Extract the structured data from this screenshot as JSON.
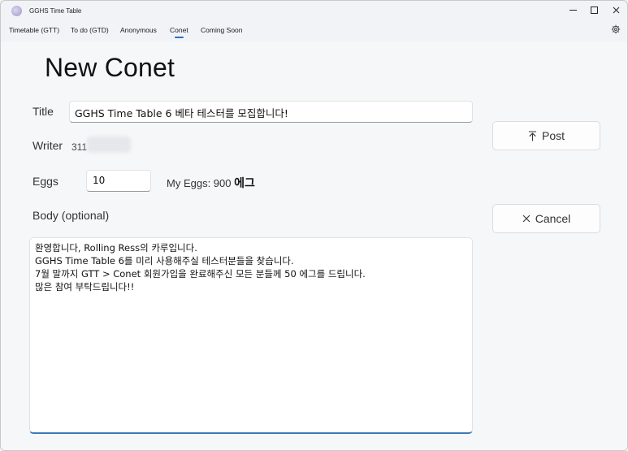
{
  "window": {
    "title": "GGHS Time Table"
  },
  "nav": {
    "tabs": [
      {
        "label": "Timetable (GTT)"
      },
      {
        "label": "To do (GTD)"
      },
      {
        "label": "Anonymous"
      },
      {
        "label": "Conet",
        "selected": true
      },
      {
        "label": "Coming Soon"
      }
    ]
  },
  "page": {
    "title": "New Conet"
  },
  "form": {
    "title_label": "Title",
    "title_value": "GGHS Time Table 6 베타 테스터를 모집합니다!",
    "writer_label": "Writer",
    "writer_value": "311",
    "eggs_label": "Eggs",
    "eggs_value": "10",
    "my_eggs_text": "My Eggs: 900",
    "my_eggs_unit": "에그",
    "body_label": "Body (optional)",
    "body_lines": [
      "환영합니다, Rolling Ress의 카루입니다.",
      "GGHS Time Table 6를 미리 사용해주실 테스터분들을 찾습니다.",
      "7월 말까지 GTT > Conet 회원가입을 완료해주신 모든 분들께 50 에그를 드립니다.",
      "많은 참여 부탁드립니다!!"
    ]
  },
  "actions": {
    "post_label": "Post",
    "cancel_label": "Cancel"
  },
  "colors": {
    "accent": "#2d6fb5"
  }
}
